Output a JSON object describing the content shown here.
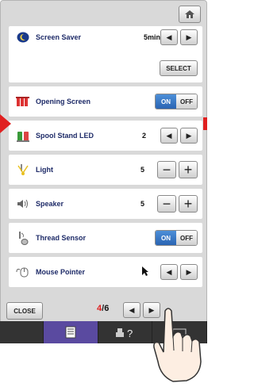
{
  "header": {
    "home_icon": "home-icon"
  },
  "settings": {
    "screen_saver": {
      "label": "Screen Saver",
      "value": "5min",
      "select_label": "SELECT"
    },
    "opening_screen": {
      "label": "Opening Screen",
      "on_label": "ON",
      "off_label": "OFF"
    },
    "spool_stand_led": {
      "label": "Spool Stand LED",
      "value": "2"
    },
    "light": {
      "label": "Light",
      "value": "5",
      "minus": "−",
      "plus": "+"
    },
    "speaker": {
      "label": "Speaker",
      "value": "5",
      "minus": "−",
      "plus": "+"
    },
    "thread_sensor": {
      "label": "Thread Sensor",
      "on_label": "ON",
      "off_label": "OFF"
    },
    "mouse_pointer": {
      "label": "Mouse Pointer"
    }
  },
  "footer": {
    "close_label": "CLOSE",
    "page_current": "4",
    "page_separator": "/",
    "page_total": "6"
  },
  "arrows": {
    "left": "◀",
    "right": "▶"
  },
  "tabs": [
    {
      "icon": "settings-page-icon",
      "active": true
    },
    {
      "icon": "help-icon",
      "active": false
    },
    {
      "icon": "sewing-icon",
      "active": false
    }
  ],
  "colors": {
    "accent": "#2a64b3",
    "label": "#1e2b68",
    "highlight": "#e02020",
    "active_tab": "#5a4aa0"
  }
}
